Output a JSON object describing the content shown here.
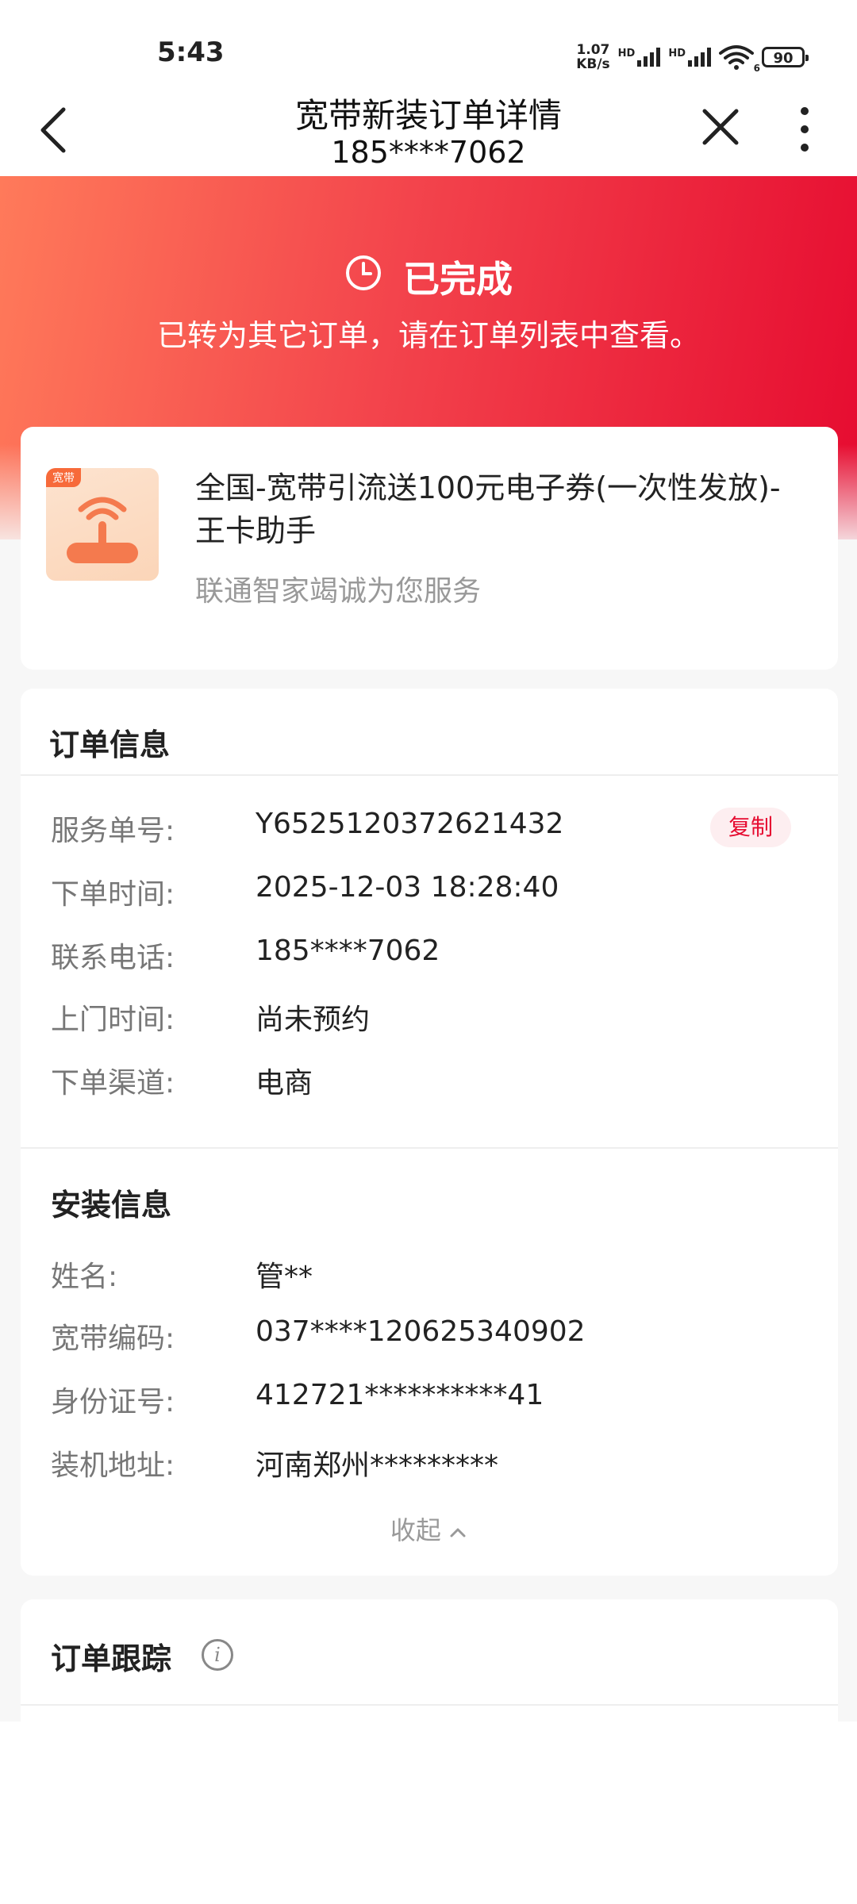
{
  "status_bar": {
    "time": "5:43",
    "net_speed_value": "1.07",
    "net_speed_unit": "KB/s",
    "sim1_label": "HD",
    "sim2_label": "HD",
    "wifi_badge": "6",
    "battery": "90"
  },
  "header": {
    "title": "宽带新装订单详情",
    "subtitle": "185****7062"
  },
  "hero": {
    "status": "已完成",
    "message": "已转为其它订单，请在订单列表中查看。"
  },
  "product": {
    "tag": "宽带",
    "title": "全国-宽带引流送100元电子券(一次性发放)-王卡助手",
    "subtitle": "联通智家竭诚为您服务"
  },
  "order_info": {
    "title": "订单信息",
    "copy_label": "复制",
    "rows": [
      {
        "label": "服务单号:",
        "value": "Y6525120372621432"
      },
      {
        "label": "下单时间:",
        "value": "2025-12-03 18:28:40"
      },
      {
        "label": "联系电话:",
        "value": "185****7062"
      },
      {
        "label": "上门时间:",
        "value": "尚未预约"
      },
      {
        "label": "下单渠道:",
        "value": "电商"
      }
    ]
  },
  "install_info": {
    "title": "安装信息",
    "rows": [
      {
        "label": "姓名:",
        "value": "管**"
      },
      {
        "label": "宽带编码:",
        "value": "037****120625340902"
      },
      {
        "label": "身份证号:",
        "value": "412721**********41"
      },
      {
        "label": "装机地址:",
        "value": "河南郑州*********"
      }
    ],
    "collapse_label": "收起"
  },
  "tracking": {
    "title": "订单跟踪",
    "info_glyph": "i"
  },
  "colors": {
    "accent": "#e60b30",
    "hero_start": "#ff7a5a",
    "hero_end": "#e60b30"
  },
  "icons": [
    "back-arrow-icon",
    "close-icon",
    "more-vertical-icon",
    "clock-icon",
    "router-icon",
    "chevron-up-icon",
    "info-icon",
    "wifi-icon",
    "signal-icon",
    "battery-icon"
  ]
}
